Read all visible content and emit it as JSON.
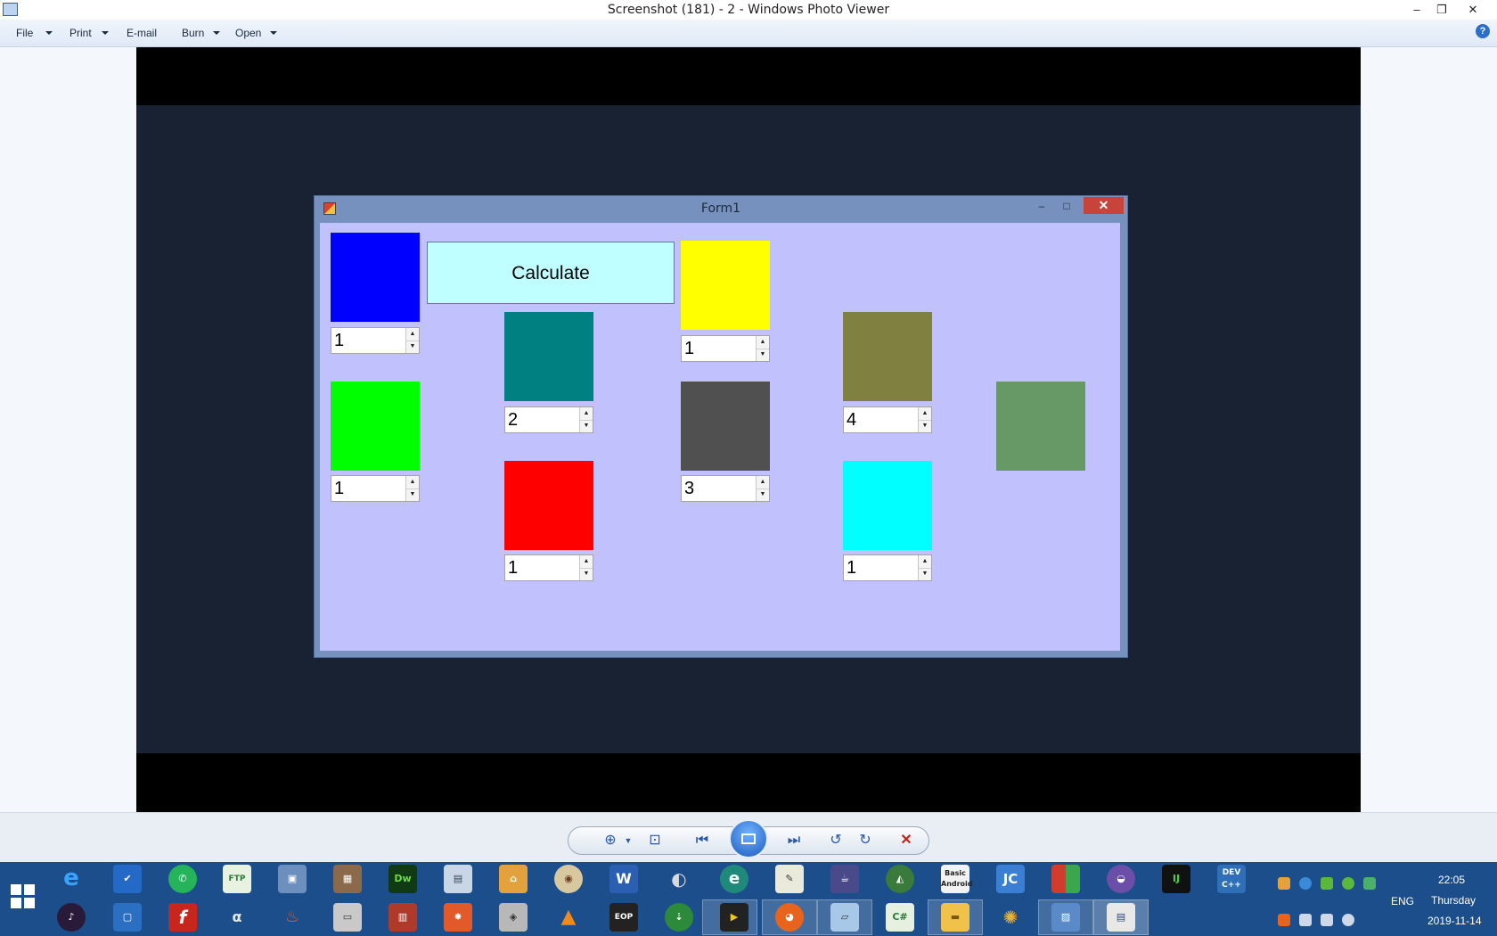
{
  "window": {
    "title": "Screenshot (181) - 2 - Windows Photo Viewer",
    "minimize": "–",
    "restore": "❐",
    "close": "✕"
  },
  "menu": {
    "items": [
      {
        "label": "File",
        "has_dropdown": true
      },
      {
        "label": "Print",
        "has_dropdown": true
      },
      {
        "label": "E-mail",
        "has_dropdown": false
      },
      {
        "label": "Burn",
        "has_dropdown": true
      },
      {
        "label": "Open",
        "has_dropdown": true
      }
    ],
    "help": "?"
  },
  "form": {
    "title": "Form1",
    "minimize": "–",
    "maximize": "□",
    "close": "✕",
    "calculate_label": "Calculate",
    "swatches": [
      {
        "color": "#0000ff"
      },
      {
        "color": "#00ff00"
      },
      {
        "color": "#008080"
      },
      {
        "color": "#ff0000"
      },
      {
        "color": "#ffff00"
      },
      {
        "color": "#505050"
      },
      {
        "color": "#808040"
      },
      {
        "color": "#00ffff"
      },
      {
        "color": "#669966"
      }
    ],
    "spinners": [
      {
        "value": "1"
      },
      {
        "value": "1"
      },
      {
        "value": "2"
      },
      {
        "value": "1"
      },
      {
        "value": "1"
      },
      {
        "value": "3"
      },
      {
        "value": "4"
      },
      {
        "value": "1"
      }
    ]
  },
  "controls": {
    "zoom": "zoom-icon",
    "fit": "fit-icon",
    "previous": "previous-icon",
    "slideshow": "slideshow-icon",
    "next": "next-icon",
    "rotate_ccw": "rotate-left-icon",
    "rotate_cw": "rotate-right-icon",
    "delete": "delete-icon"
  },
  "taskbar": {
    "language": "ENG",
    "time": "22:05",
    "day": "Thursday",
    "date": "2019-11-14",
    "app_labels": {
      "dreamweaver": "Dw",
      "word": "W",
      "ie": "e",
      "basic_android": "Basic Android",
      "jcreator": "JC",
      "intellij": "IJ",
      "devcpp": "DEV C++",
      "flash": "f",
      "csharp": "C#",
      "eop": "EOP"
    }
  }
}
